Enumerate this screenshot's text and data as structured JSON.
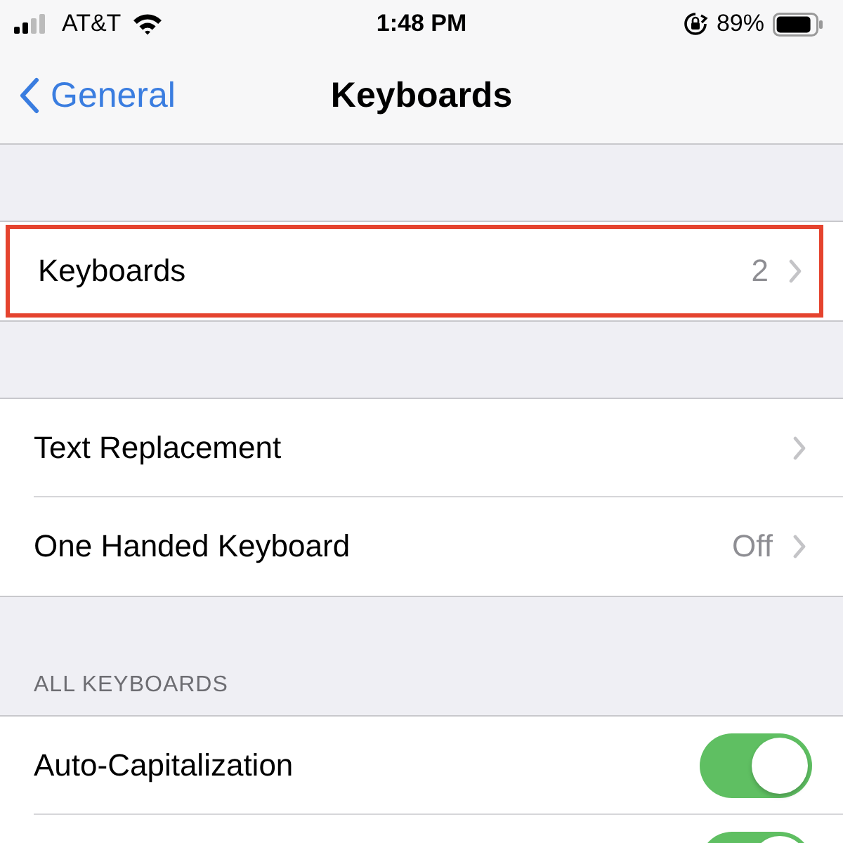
{
  "status_bar": {
    "carrier": "AT&T",
    "time": "1:48 PM",
    "battery": "89%",
    "orientation_lock": true
  },
  "nav": {
    "back": "General",
    "title": "Keyboards"
  },
  "groups": [
    {
      "rows": [
        {
          "kind": "disclosure",
          "label": "Keyboards",
          "value": "2",
          "highlighted": true
        }
      ]
    },
    {
      "rows": [
        {
          "kind": "disclosure",
          "label": "Text Replacement",
          "highlighted": false
        },
        {
          "kind": "disclosure",
          "label": "One Handed Keyboard",
          "value": "Off",
          "highlighted": false
        }
      ]
    },
    {
      "header": "ALL KEYBOARDS",
      "rows": [
        {
          "kind": "toggle",
          "label": "Auto-Capitalization",
          "on": true,
          "highlighted": false
        },
        {
          "kind": "toggle",
          "on": true
        }
      ]
    }
  ]
}
